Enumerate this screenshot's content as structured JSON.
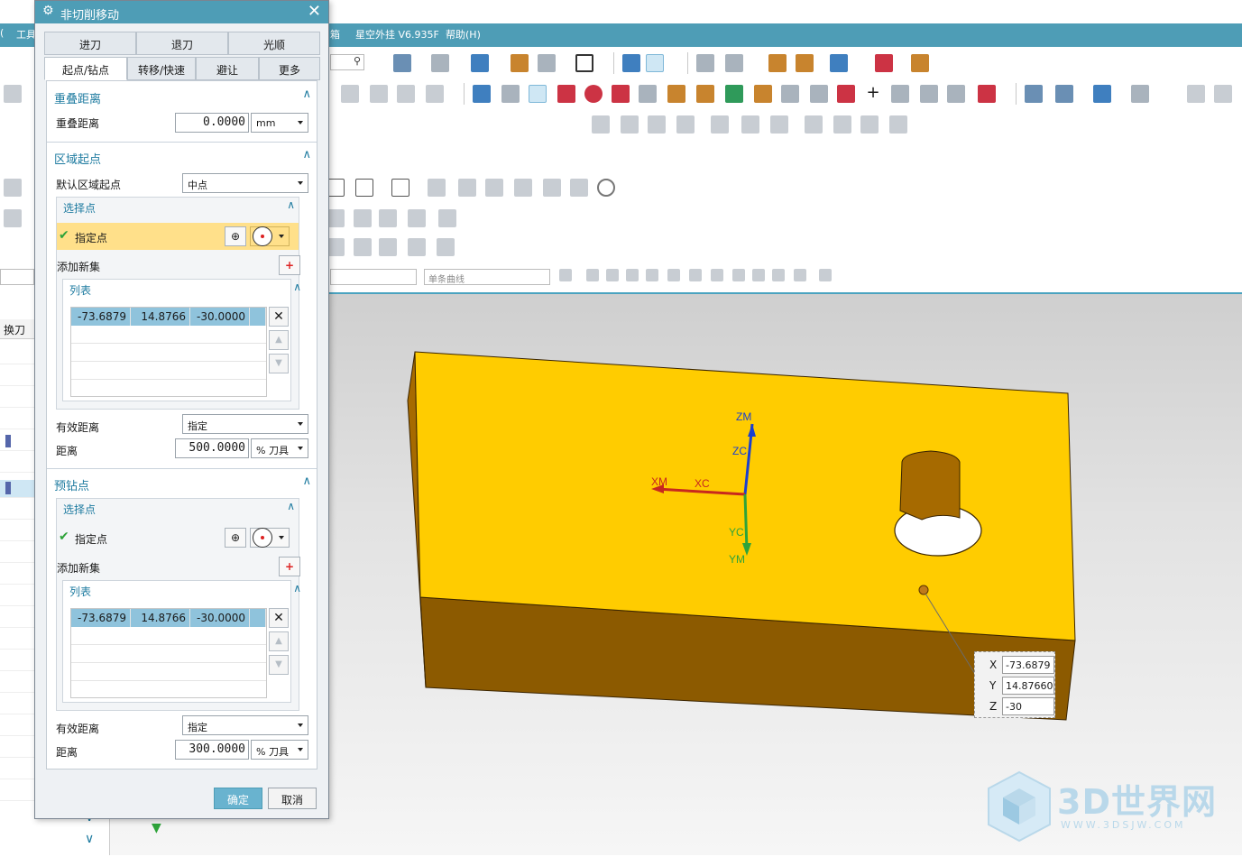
{
  "menubar": {
    "items": [
      "工具",
      "星空外挂 V6.935F",
      "帮助(H)"
    ],
    "left_fragment": "(",
    "partial_item": "箱"
  },
  "toolbar": {
    "curve_filter_placeholder": "单条曲线"
  },
  "left_panel": {
    "column_header": "换刀"
  },
  "dialog": {
    "title": "非切削移动",
    "tabs_row1": [
      "进刀",
      "退刀",
      "光顺"
    ],
    "tabs_row2": [
      "起点/钻点",
      "转移/快速",
      "避让",
      "更多"
    ],
    "selected_tab": "起点/钻点",
    "overlap": {
      "header": "重叠距离",
      "field_label": "重叠距离",
      "value": "0.0000",
      "unit": "mm"
    },
    "region_start": {
      "header": "区域起点",
      "default_label": "默认区域起点",
      "default_value": "中点",
      "select_point": {
        "header": "选择点",
        "specify_label": "指定点",
        "add_new_label": "添加新集",
        "list_header": "列表",
        "rows": [
          [
            "-73.6879",
            "14.8766",
            "-30.0000"
          ]
        ]
      },
      "valid_distance_label": "有效距离",
      "valid_distance_value": "指定",
      "distance_label": "距离",
      "distance_value": "500.0000",
      "distance_unit": "% 刀具"
    },
    "predrill": {
      "header": "预钻点",
      "select_point": {
        "header": "选择点",
        "specify_label": "指定点",
        "add_new_label": "添加新集",
        "list_header": "列表",
        "rows": [
          [
            "-73.6879",
            "14.8766",
            "-30.0000"
          ]
        ]
      },
      "valid_distance_label": "有效距离",
      "valid_distance_value": "指定",
      "distance_label": "距离",
      "distance_value": "300.0000",
      "distance_unit": "% 刀具"
    },
    "ok_label": "确定",
    "cancel_label": "取消"
  },
  "viewport": {
    "axes": {
      "zm": "ZM",
      "zc": "ZC",
      "xm": "XM",
      "xc": "XC",
      "yc": "YC",
      "ym": "YM"
    },
    "coord_readout": {
      "x_label": "X",
      "x_value": "-73.6879",
      "y_label": "Y",
      "y_value": "14.87660",
      "z_label": "Z",
      "z_value": "-30"
    },
    "part_color_top": "#ffcc00",
    "part_color_side": "#8c5a00"
  },
  "watermark": {
    "text": "3D世界网",
    "url": "WWW.3DSJW.COM"
  },
  "colors": {
    "accent": "#4e9db6",
    "section_text": "#1e7ba0",
    "highlight": "#ffe08a"
  }
}
